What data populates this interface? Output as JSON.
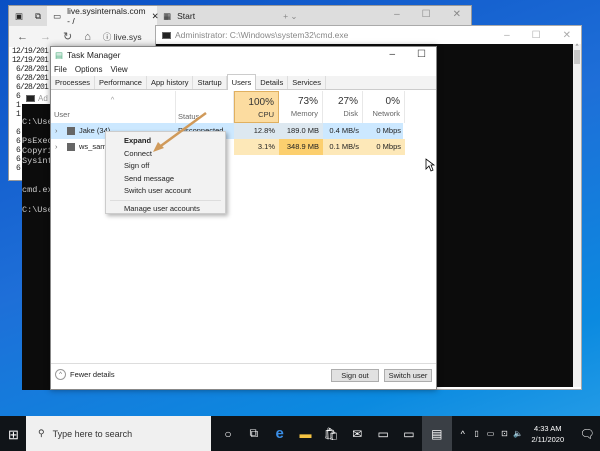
{
  "browser": {
    "tabs": [
      {
        "label": "live.sysinternals.com - /"
      },
      {
        "label": "Start"
      }
    ],
    "address": "live.sys",
    "content_lines": [
      "12/19/201",
      "12/19/201",
      " 6/28/201",
      " 6/28/201",
      " 6/28/201",
      " 6",
      " 1",
      " 1",
      "",
      " 6",
      " 6",
      " 6",
      " 6",
      " 6"
    ]
  },
  "cmd": {
    "title": "Administrator: C:\\Windows\\system32\\cmd.exe"
  },
  "cmd2": {
    "title": "Ad",
    "lines": [
      "",
      "C:\\Use",
      "",
      "PsExec",
      "Copyri",
      "Sysint",
      "",
      "",
      "cmd.ex",
      "",
      "C:\\Use"
    ]
  },
  "taskmanager": {
    "title": "Task Manager",
    "menu": [
      "File",
      "Options",
      "View"
    ],
    "tabs": [
      "Processes",
      "Performance",
      "App history",
      "Startup",
      "Users",
      "Details",
      "Services"
    ],
    "active_tab": "Users",
    "columns": {
      "user": "User",
      "status": "Status",
      "cpu": {
        "pct": "100%",
        "name": "CPU"
      },
      "memory": {
        "pct": "73%",
        "name": "Memory"
      },
      "disk": {
        "pct": "27%",
        "name": "Disk"
      },
      "network": {
        "pct": "0%",
        "name": "Network"
      }
    },
    "rows": [
      {
        "user": "Jake (34)",
        "status": "Disconnected",
        "cpu": "12.8%",
        "memory": "189.0 MB",
        "disk": "0.4 MB/s",
        "network": "0 Mbps"
      },
      {
        "user": "ws_sam",
        "status": "",
        "cpu": "3.1%",
        "memory": "348.9 MB",
        "disk": "0.1 MB/s",
        "network": "0 Mbps"
      }
    ],
    "fewer_details": "Fewer details",
    "sign_out": "Sign out",
    "switch_user": "Switch user"
  },
  "context_menu": [
    "Expand",
    "Connect",
    "Sign off",
    "Send message",
    "Switch user account",
    "Manage user accounts"
  ],
  "taskbar": {
    "search_placeholder": "Type here to search",
    "time": "4:33 AM",
    "date": "2/11/2020"
  }
}
